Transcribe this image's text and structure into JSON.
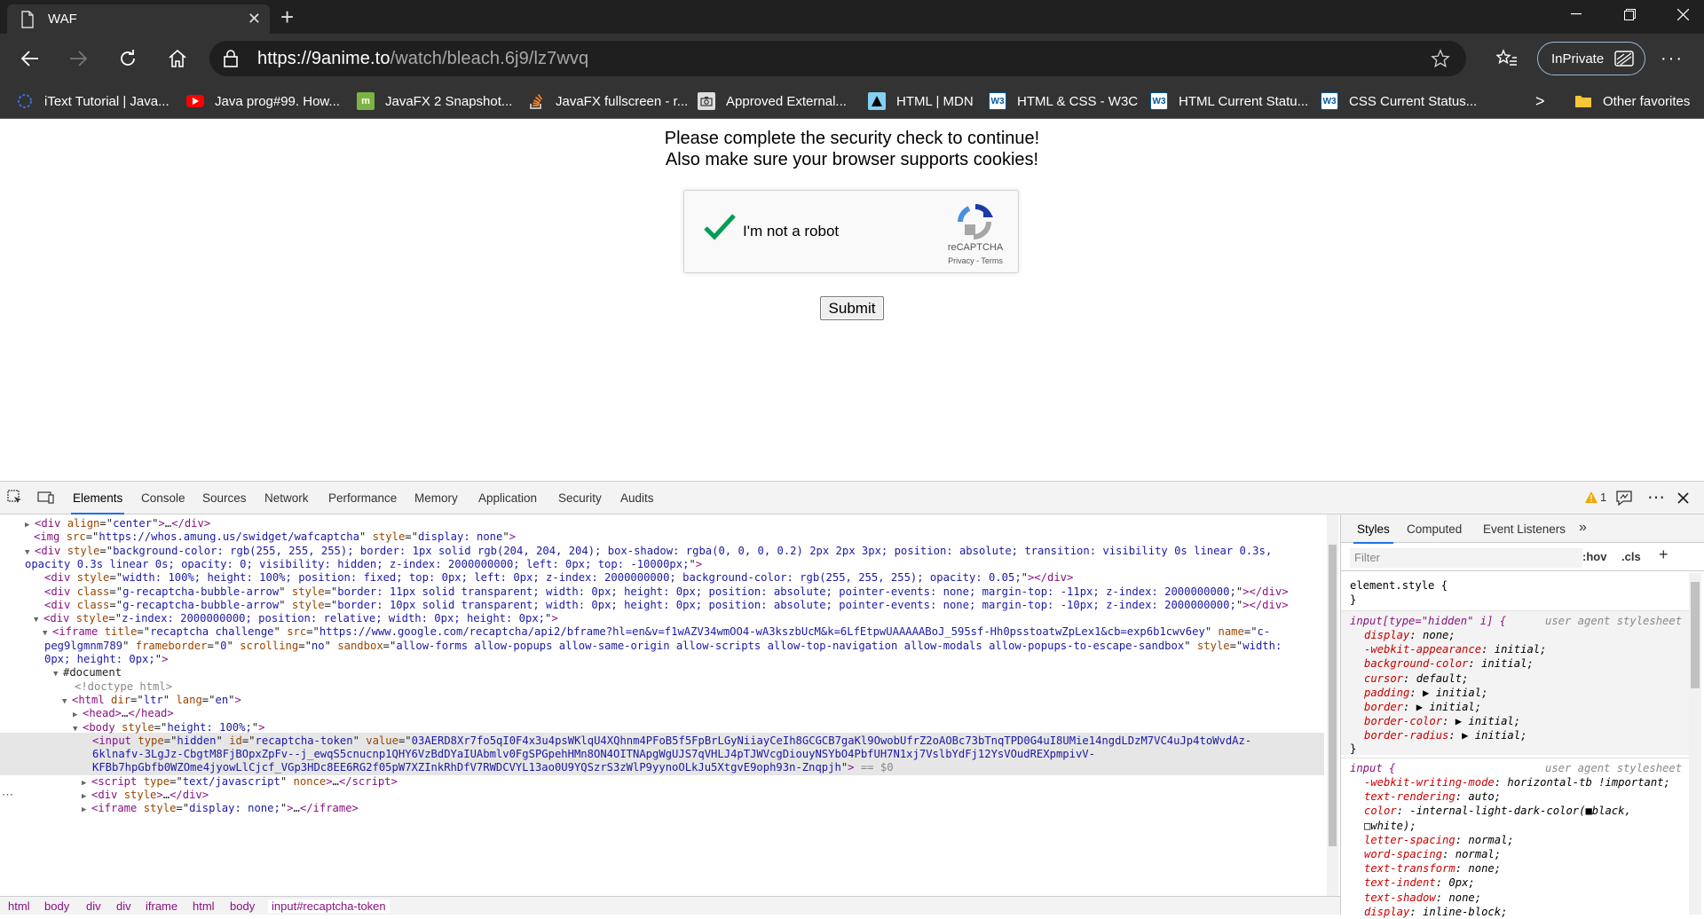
{
  "browser": {
    "tab_title": "WAF",
    "new_tab_symbol": "+",
    "url_host": "https://9anime.to",
    "url_path": "/watch/bleach.6j9/lz7wvq",
    "inprivate_label": "InPrivate",
    "favorites": [
      {
        "label": "iText Tutorial | Java...",
        "icon": "itext-icon",
        "color": "#3b6fd6"
      },
      {
        "label": "Java prog#99. How...",
        "icon": "youtube-icon",
        "color": "#ff0000"
      },
      {
        "label": "JavaFX 2 Snapshot...",
        "icon": "m-icon",
        "color": "#7cb342"
      },
      {
        "label": "JavaFX fullscreen - r...",
        "icon": "stackoverflow-icon",
        "color": "#f48024"
      },
      {
        "label": "Approved External...",
        "icon": "camera-icon",
        "color": "#dddddd"
      },
      {
        "label": "HTML | MDN",
        "icon": "mdn-icon",
        "color": "#83d0f2"
      },
      {
        "label": "HTML & CSS - W3C",
        "icon": "w3c-icon",
        "color": "#005a9c"
      },
      {
        "label": "HTML Current Statu...",
        "icon": "w3c-icon",
        "color": "#005a9c"
      },
      {
        "label": "CSS Current Status...",
        "icon": "w3c-icon",
        "color": "#005a9c"
      }
    ],
    "more_favorites_symbol": ">",
    "other_favorites": "Other favorites"
  },
  "page": {
    "message_line1": "Please complete the security check to continue!",
    "message_line2": "Also make sure your browser supports cookies!",
    "captcha_label": "I'm not a robot",
    "recaptcha_brand": "reCAPTCHA",
    "recaptcha_links": "Privacy - Terms",
    "submit_label": "Submit"
  },
  "devtools": {
    "tabs": [
      "Elements",
      "Console",
      "Sources",
      "Network",
      "Performance",
      "Memory",
      "Application",
      "Security",
      "Audits"
    ],
    "active_tab": "Elements",
    "warning_count": "1",
    "breadcrumbs": [
      "html",
      "body",
      "div",
      "div",
      "iframe",
      "html",
      "body",
      "input#recaptcha-token"
    ],
    "styles_tabs": [
      "Styles",
      "Computed",
      "Event Listeners"
    ],
    "styles_more": "»",
    "filter_placeholder": "Filter",
    "hov_label": ":hov",
    "cls_label": ".cls",
    "add_rule": "+",
    "element_style": "element.style {",
    "close_brace": "}",
    "rule1_selector": "input[type=\"hidden\" i] {",
    "rule1_source": "user agent stylesheet",
    "rule1_props": [
      "display: none;",
      "-webkit-appearance: initial;",
      "background-color: initial;",
      "cursor: default;",
      "padding: ▶ initial;",
      "border: ▶ initial;",
      "border-color: ▶ initial;",
      "border-radius: ▶ initial;"
    ],
    "rule2_selector": "input {",
    "rule2_source": "user agent stylesheet",
    "rule2_props": [
      "-webkit-writing-mode: horizontal-tb !important;",
      "text-rendering: auto;",
      "color: -internal-light-dark-color(■black,",
      "      □white);",
      "letter-spacing: normal;",
      "word-spacing: normal;",
      "text-transform: none;",
      "text-indent: 0px;",
      "text-shadow: none;",
      "display: inline-block;"
    ],
    "dom_lines": [
      {
        "indent": 30,
        "tri": "▶",
        "html": "<span class=\"tag\">&lt;div</span> <span class=\"an\">align</span>=\"<span class=\"av\">center</span>\"<span class=\"tag\">&gt;</span>…<span class=\"tag\">&lt;/div&gt;</span>"
      },
      {
        "indent": 38,
        "tri": "",
        "html": "<span class=\"tag\">&lt;img</span> <span class=\"an\">src</span>=\"<span class=\"av\">https://whos.amung.us/swidget/wafcaptcha</span>\" <span class=\"an\">style</span>=\"<span class=\"av\">display: none</span>\"<span class=\"tag\">&gt;</span>"
      },
      {
        "indent": 30,
        "tri": "▼",
        "html": "<span class=\"tag\">&lt;div</span> <span class=\"an\">style</span>=\"<span class=\"av\">background-color: rgb(255, 255, 255); border: 1px solid rgb(204, 204, 204); box-shadow: rgba(0, 0, 0, 0.2) 2px 2px 3px; position: absolute; transition: visibility 0s linear 0.3s,</span>"
      },
      {
        "indent": 28,
        "tri": "",
        "html": "<span class=\"av\">opacity 0.3s linear 0s; opacity: 0; visibility: hidden; z-index: 2000000000; left: 0px; top: -10000px;</span>\"<span class=\"tag\">&gt;</span>"
      },
      {
        "indent": 50,
        "tri": "",
        "html": "<span class=\"tag\">&lt;div</span> <span class=\"an\">style</span>=\"<span class=\"av\">width: 100%; height: 100%; position: fixed; top: 0px; left: 0px; z-index: 2000000000; background-color: rgb(255, 255, 255); opacity: 0.05;</span>\"<span class=\"tag\">&gt;&lt;/div&gt;</span>"
      },
      {
        "indent": 50,
        "tri": "",
        "html": "<span class=\"tag\">&lt;div</span> <span class=\"an\">class</span>=\"<span class=\"av\">g-recaptcha-bubble-arrow</span>\" <span class=\"an\">style</span>=\"<span class=\"av\">border: 11px solid transparent; width: 0px; height: 0px; position: absolute; pointer-events: none; margin-top: -11px; z-index: 2000000000;</span>\"<span class=\"tag\">&gt;&lt;/div&gt;</span>"
      },
      {
        "indent": 50,
        "tri": "",
        "html": "<span class=\"tag\">&lt;div</span> <span class=\"an\">class</span>=\"<span class=\"av\">g-recaptcha-bubble-arrow</span>\" <span class=\"an\">style</span>=\"<span class=\"av\">border: 10px solid transparent; width: 0px; height: 0px; position: absolute; pointer-events: none; margin-top: -10px; z-index: 2000000000;</span>\"<span class=\"tag\">&gt;&lt;/div&gt;</span>"
      },
      {
        "indent": 40,
        "tri": "▼",
        "html": "<span class=\"tag\">&lt;div</span> <span class=\"an\">style</span>=\"<span class=\"av\">z-index: 2000000000; position: relative; width: 0px; height: 0px;</span>\"<span class=\"tag\">&gt;</span>"
      },
      {
        "indent": 50,
        "tri": "▼",
        "html": "<span class=\"tag\">&lt;iframe</span> <span class=\"an\">title</span>=\"<span class=\"av\">recaptcha challenge</span>\" <span class=\"an\">src</span>=\"<span class=\"av\">https://www.google.com/recaptcha/api2/bframe?hl=en&amp;v=f1wAZV34wmOO4-wA3kszbUcM&amp;k=6LfEtpwUAAAAABoJ_595sf-Hh0psstoatwZpLex1&amp;cb=exp6b1cwv6ey</span>\" <span class=\"an\">name</span>=\"<span class=\"av\">c-</span>"
      },
      {
        "indent": 50,
        "tri": "",
        "html": "<span class=\"av\">peg9lgmnm789</span>\" <span class=\"an\">frameborder</span>=\"<span class=\"av\">0</span>\" <span class=\"an\">scrolling</span>=\"<span class=\"av\">no</span>\" <span class=\"an\">sandbox</span>=\"<span class=\"av\">allow-forms allow-popups allow-same-origin allow-scripts allow-top-navigation allow-modals allow-popups-to-escape-sandbox</span>\" <span class=\"an\">style</span>=\"<span class=\"av\">width:</span>"
      },
      {
        "indent": 50,
        "tri": "",
        "html": "<span class=\"av\">0px; height: 0px;</span>\"<span class=\"tag\">&gt;</span>"
      },
      {
        "indent": 62,
        "tri": "▼",
        "html": "#document"
      },
      {
        "indent": 84,
        "tri": "",
        "html": "<span class=\"dim\">&lt;!doctype html&gt;</span>"
      },
      {
        "indent": 72,
        "tri": "▼",
        "html": "<span class=\"tag\">&lt;html</span> <span class=\"an\">dir</span>=\"<span class=\"av\">ltr</span>\" <span class=\"an\">lang</span>=\"<span class=\"av\">en</span>\"<span class=\"tag\">&gt;</span>"
      },
      {
        "indent": 84,
        "tri": "▶",
        "html": "<span class=\"tag\">&lt;head&gt;</span>…<span class=\"tag\">&lt;/head&gt;</span>"
      },
      {
        "indent": 84,
        "tri": "▼",
        "html": "<span class=\"tag\">&lt;body</span> <span class=\"an\">style</span>=\"<span class=\"av\">height: 100%;</span>\"<span class=\"tag\">&gt;</span>"
      },
      {
        "indent": 104,
        "tri": "",
        "sel": true,
        "html": "<span class=\"tag\">&lt;input</span> <span class=\"an\">type</span>=\"<span class=\"av\">hidden</span>\" <span class=\"an\">id</span>=\"<span class=\"av\">recaptcha-token</span>\" <span class=\"an\">value</span>=\"<span class=\"av\">03AERD8Xr7fo5qI0F4x3u4psWKlqU4XQhnm4PFoB5f5FpBrLGyNiiayCeIh8GCGCB7gaKl9OwobUfrZ2oAOBc73bTnqTPD0G4uI8UMie14ngdLDzM7VC4uJp4toWvdAz-</span>"
      },
      {
        "indent": 104,
        "tri": "",
        "sel": true,
        "html": "<span class=\"av\">6klnafv-3LgJz-CbgtM8FjBOpxZpFv--j_ewqS5cnucnp1QHY6VzBdDYaIUAbmlv0FgSPGpehHMn8ON4OITNApgWgUJS7qVHLJ4pTJWVcgDiouyNSYbO4PbfUH7N1xj7VslbYdFj12YsVOudREXpmpivV-</span>"
      },
      {
        "indent": 104,
        "tri": "",
        "sel": true,
        "html": "<span class=\"av\">KFBb7hpGbfb0WZOme4jyowLlCjcf_VGp3HDc8EE6RG2f05pW7XZInkRhDfV7RWDCVYL13ao0U9YQSzrS3zWlP9yynoOLkJu5XtgvE9oph93n-Znqpjh</span>\"<span class=\"tag\">&gt;</span> <span class=\"dim\">== $0</span>"
      },
      {
        "indent": 94,
        "tri": "▶",
        "html": "<span class=\"tag\">&lt;script</span> <span class=\"an\">type</span>=\"<span class=\"av\">text/javascript</span>\" <span class=\"an\">nonce</span><span class=\"tag\">&gt;</span>…<span class=\"tag\">&lt;/script&gt;</span>"
      },
      {
        "indent": 94,
        "tri": "▶",
        "html": "<span class=\"tag\">&lt;div</span> <span class=\"an\">style</span><span class=\"tag\">&gt;</span>…<span class=\"tag\">&lt;/div&gt;</span>"
      },
      {
        "indent": 94,
        "tri": "▶",
        "html": "<span class=\"tag\">&lt;iframe</span> <span class=\"an\">style</span>=\"<span class=\"av\">display: none;</span>\"<span class=\"tag\">&gt;</span>…<span class=\"tag\">&lt;/iframe&gt;</span>"
      }
    ]
  }
}
